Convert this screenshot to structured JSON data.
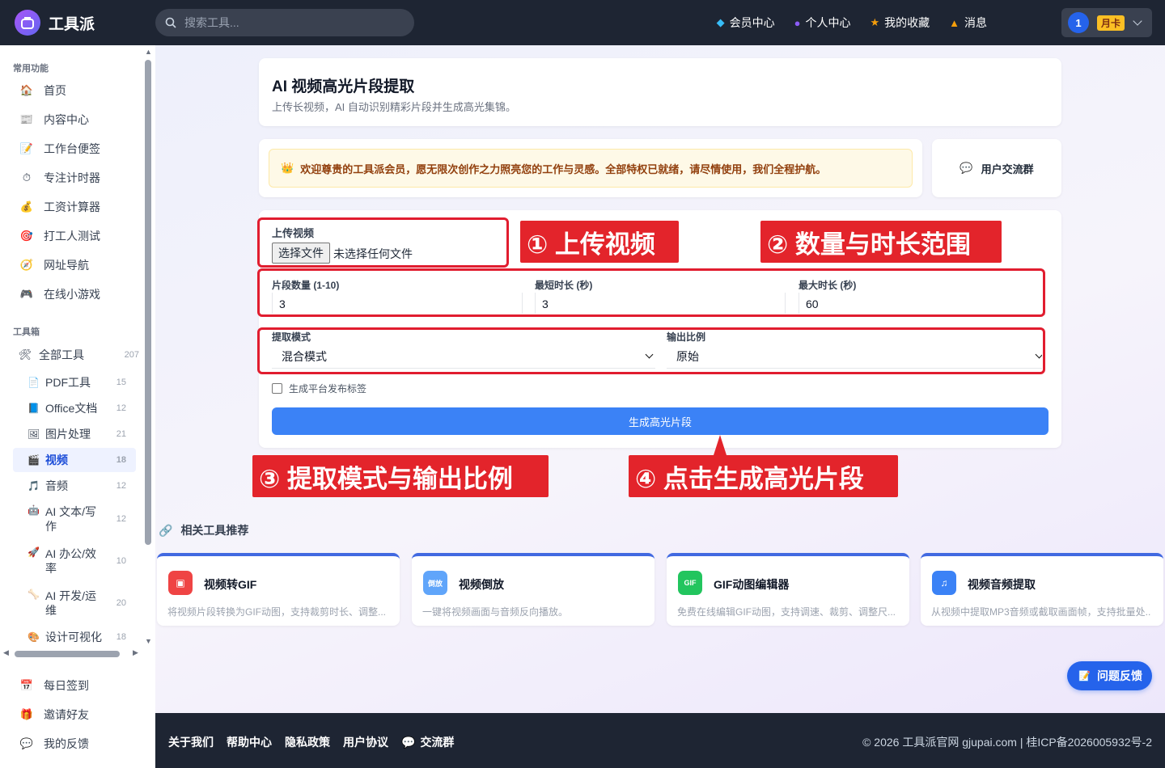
{
  "app": {
    "logo_text": "工具派",
    "search_placeholder": "搜索工具..."
  },
  "nav": [
    {
      "icon": "diamond-icon",
      "label": "会员中心",
      "color": "#38bdf8"
    },
    {
      "icon": "user-icon",
      "label": "个人中心",
      "color": "#8b5cf6"
    },
    {
      "icon": "star-icon",
      "label": "我的收藏",
      "color": "#f59e0b"
    },
    {
      "icon": "bell-icon",
      "label": "消息",
      "color": "#f59e0b"
    }
  ],
  "user": {
    "avatar": "1",
    "plan": "月卡"
  },
  "sidebar": {
    "common_heading": "常用功能",
    "common": [
      "首页",
      "内容中心",
      "工作台便签",
      "专注计时器",
      "工资计算器",
      "打工人测试",
      "网址导航",
      "在线小游戏"
    ],
    "toolbox_heading": "工具箱",
    "all_tools": {
      "label": "全部工具",
      "count": "207"
    },
    "categories": [
      {
        "label": "PDF工具",
        "count": "15"
      },
      {
        "label": "Office文档",
        "count": "12"
      },
      {
        "label": "图片处理",
        "count": "21"
      },
      {
        "label": "视频",
        "count": "18"
      },
      {
        "label": "音频",
        "count": "12"
      },
      {
        "label": "AI 文本/写作",
        "count": "12"
      },
      {
        "label": "AI 办公/效率",
        "count": "10"
      },
      {
        "label": "AI 开发/运维",
        "count": "20"
      },
      {
        "label": "设计可视化",
        "count": "18"
      }
    ],
    "bottom": [
      "每日签到",
      "邀请好友",
      "我的反馈"
    ]
  },
  "header_card": {
    "title": "AI 视频高光片段提取",
    "subtitle": "上传长视频，AI 自动识别精彩片段并生成高光集锦。"
  },
  "notice": {
    "text": "欢迎尊贵的工具派会员，愿无限次创作之力照亮您的工作与灵感。全部特权已就绪，请尽情使用，我们全程护航。",
    "group_label": "用户交流群"
  },
  "form": {
    "upload_label": "上传视频",
    "file_button": "选择文件",
    "file_status": "未选择任何文件",
    "count_label": "片段数量 (1-10)",
    "count_value": "3",
    "min_label": "最短时长 (秒)",
    "min_value": "3",
    "max_label": "最大时长 (秒)",
    "max_value": "60",
    "mode_label": "提取模式",
    "mode_value": "混合模式",
    "ratio_label": "输出比例",
    "ratio_value": "原始",
    "tags_label": "生成平台发布标签",
    "tags_checked": false,
    "submit": "生成高光片段"
  },
  "callouts": [
    "① 上传视频",
    "② 数量与时长范围",
    "③ 提取模式与输出比例",
    "④ 点击生成高光片段"
  ],
  "related": {
    "heading": "相关工具推荐",
    "tools": [
      {
        "name": "视频转GIF",
        "desc": "将视频片段转换为GIF动图，支持裁剪时长、调整...",
        "icon": "video-icon",
        "color": "#ef4444"
      },
      {
        "name": "视频倒放",
        "desc": "一键将视频画面与音频反向播放。",
        "icon": "reverse-icon",
        "color": "#60a5fa",
        "icon_text": "倒放"
      },
      {
        "name": "GIF动图编辑器",
        "desc": "免费在线编辑GIF动图，支持调速、裁剪、调整尺...",
        "icon": "gif-icon",
        "color": "#22c55e",
        "icon_text": "GIF"
      },
      {
        "name": "视频音频提取",
        "desc": "从视频中提取MP3音频或截取画面帧，支持批量处...",
        "icon": "music-icon",
        "color": "#3b82f6"
      }
    ]
  },
  "footer": {
    "links": [
      "关于我们",
      "帮助中心",
      "隐私政策",
      "用户协议",
      "交流群"
    ],
    "copyright": "© 2026 工具派官网 gjupai.com | 桂ICP备2026005932号-2"
  },
  "feedback_button": "问题反馈"
}
